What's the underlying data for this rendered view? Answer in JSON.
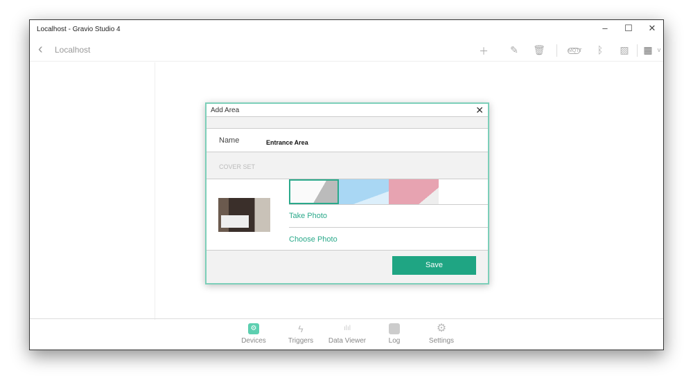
{
  "window": {
    "title": "Localhost - Gravio Studio 4",
    "minimize": "–",
    "maximize": "☐",
    "close": "✕"
  },
  "nav": {
    "back": "‹",
    "title": "Localhost",
    "icons": [
      "plus-icon",
      "edit-icon",
      "trash-icon",
      "mqtt-icon",
      "bluetooth-icon",
      "image-icon",
      "layout-icon"
    ],
    "mqtt": "MQTT"
  },
  "dialog": {
    "title": "Add Area",
    "close": "✕",
    "name_label": "Name",
    "name_value": "Entrance Area",
    "cover_label": "COVER SET",
    "take_photo": "Take Photo",
    "choose_photo": "Choose Photo",
    "save": "Save"
  },
  "bottom": [
    {
      "label": "Devices",
      "active": true
    },
    {
      "label": "Triggers"
    },
    {
      "label": "Data Viewer"
    },
    {
      "label": "Log"
    },
    {
      "label": "Settings"
    }
  ],
  "colors": {
    "accent": "#1fa583"
  }
}
